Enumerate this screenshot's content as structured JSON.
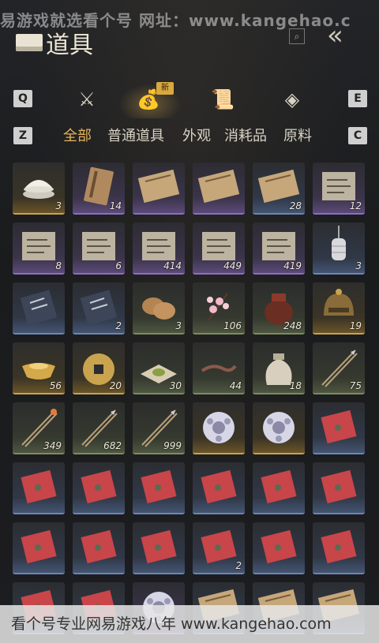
{
  "watermark_top": "易游戏就选看个号  网址：www.kangehao.c",
  "header": {
    "title": "道具"
  },
  "category_keys": {
    "left": "Q",
    "right": "E"
  },
  "category_icons": [
    "crossed-swords-icon",
    "money-bag-icon",
    "scroll-icon",
    "gem-icon"
  ],
  "new_badge": "新",
  "filter_keys": {
    "left": "Z",
    "right": "C"
  },
  "filters": [
    "全部",
    "普通道具",
    "外观",
    "消耗品",
    "原料"
  ],
  "items": [
    {
      "icon": "porcelain-bowl-icon",
      "count": "3",
      "rarity": "gold"
    },
    {
      "icon": "book-icon",
      "count": "14",
      "rarity": "purple"
    },
    {
      "icon": "scroll-icon",
      "count": "",
      "rarity": "purple"
    },
    {
      "icon": "scroll-icon",
      "count": "",
      "rarity": "purple"
    },
    {
      "icon": "scroll-icon",
      "count": "28",
      "rarity": "blue"
    },
    {
      "icon": "document-icon",
      "count": "12",
      "rarity": "purple"
    },
    {
      "icon": "document-icon",
      "count": "8",
      "rarity": "purple"
    },
    {
      "icon": "document-icon",
      "count": "6",
      "rarity": "purple"
    },
    {
      "icon": "document-icon",
      "count": "414",
      "rarity": "purple"
    },
    {
      "icon": "document-icon",
      "count": "449",
      "rarity": "purple"
    },
    {
      "icon": "document-icon",
      "count": "419",
      "rarity": "purple"
    },
    {
      "icon": "lantern-icon",
      "count": "3",
      "rarity": "blue"
    },
    {
      "icon": "talisman-icon",
      "count": "",
      "rarity": "blue"
    },
    {
      "icon": "talisman-icon",
      "count": "2",
      "rarity": "blue"
    },
    {
      "icon": "flatbread-icon",
      "count": "3",
      "rarity": "green"
    },
    {
      "icon": "blossom-icon",
      "count": "106",
      "rarity": "green"
    },
    {
      "icon": "wine-jar-icon",
      "count": "248",
      "rarity": "green"
    },
    {
      "icon": "bronze-helmet-icon",
      "count": "19",
      "rarity": "gold"
    },
    {
      "icon": "gold-ingot-icon",
      "count": "56",
      "rarity": "gold"
    },
    {
      "icon": "coin-icon",
      "count": "20",
      "rarity": "gold"
    },
    {
      "icon": "herb-powder-icon",
      "count": "30",
      "rarity": "green"
    },
    {
      "icon": "worm-icon",
      "count": "44",
      "rarity": "green"
    },
    {
      "icon": "cloth-bag-icon",
      "count": "18",
      "rarity": "green"
    },
    {
      "icon": "arrows-icon",
      "count": "75",
      "rarity": "green"
    },
    {
      "icon": "fire-arrows-icon",
      "count": "349",
      "rarity": "green"
    },
    {
      "icon": "arrows-icon",
      "count": "682",
      "rarity": "green"
    },
    {
      "icon": "arrows-icon",
      "count": "999",
      "rarity": "green"
    },
    {
      "icon": "jade-ball-icon",
      "count": "",
      "rarity": "gold"
    },
    {
      "icon": "jade-ball-icon",
      "count": "",
      "rarity": "gold"
    },
    {
      "icon": "red-envelope-icon",
      "count": "",
      "rarity": "blue"
    },
    {
      "icon": "red-envelope-icon",
      "count": "",
      "rarity": "blue"
    },
    {
      "icon": "red-envelope-icon",
      "count": "",
      "rarity": "blue"
    },
    {
      "icon": "red-envelope-icon",
      "count": "",
      "rarity": "blue"
    },
    {
      "icon": "red-envelope-icon",
      "count": "",
      "rarity": "blue"
    },
    {
      "icon": "red-envelope-icon",
      "count": "",
      "rarity": "blue"
    },
    {
      "icon": "red-envelope-icon",
      "count": "",
      "rarity": "blue"
    },
    {
      "icon": "red-envelope-icon",
      "count": "",
      "rarity": "blue"
    },
    {
      "icon": "red-envelope-icon",
      "count": "",
      "rarity": "blue"
    },
    {
      "icon": "red-envelope-icon",
      "count": "",
      "rarity": "blue"
    },
    {
      "icon": "red-envelope-icon",
      "count": "2",
      "rarity": "blue"
    },
    {
      "icon": "red-envelope-icon",
      "count": "",
      "rarity": "blue"
    },
    {
      "icon": "red-envelope-icon",
      "count": "",
      "rarity": "blue"
    },
    {
      "icon": "red-envelope-icon",
      "count": "",
      "rarity": "blue"
    },
    {
      "icon": "red-envelope-icon",
      "count": "",
      "rarity": "blue"
    },
    {
      "icon": "jade-ball-icon",
      "count": "",
      "rarity": "purple"
    },
    {
      "icon": "scroll-icon",
      "count": "",
      "rarity": "blue"
    },
    {
      "icon": "scroll-icon",
      "count": "",
      "rarity": "blue"
    },
    {
      "icon": "scroll-icon",
      "count": "",
      "rarity": "blue"
    }
  ],
  "watermark_bottom": "看个号专业网易游戏八年  www.kangehao.com"
}
